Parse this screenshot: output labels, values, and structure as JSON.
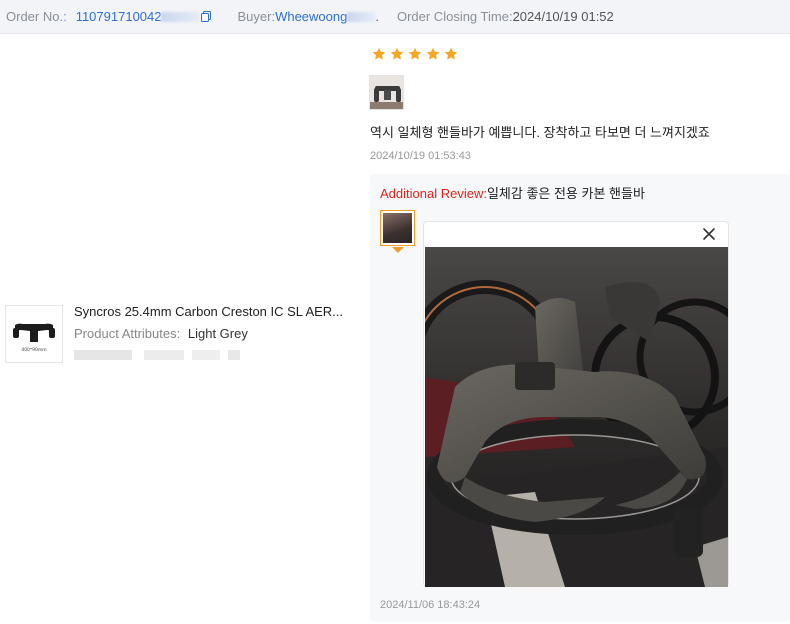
{
  "header": {
    "order_label": "Order No.:",
    "order_value": "110791710042",
    "buyer_label": "Buyer:",
    "buyer_value": "Wheewoong",
    "buyer_suffix": ".",
    "closing_label": "Order Closing Time:",
    "closing_value": "2024/10/19 01:52"
  },
  "product": {
    "title": "Syncros 25.4mm Carbon Creston IC SL AER...",
    "attr_label": "Product Attributes",
    "attr_sep": ":",
    "attr_value": "Light Grey",
    "thumb_caption": "400*90mm"
  },
  "review": {
    "rating": 5,
    "text": "역시 일체형 핸들바가 예쁩니다. 장착하고 타보면 더 느껴지겠죠",
    "time": "2024/10/19 01:53:43"
  },
  "additional": {
    "label": "Additional Review:",
    "text": "일체감 좋은 전용 카본 핸들바",
    "time": "2024/11/06 18:43:24"
  },
  "colors": {
    "star": "#f5a623",
    "link": "#2f6fd6",
    "additional_label": "#e0241b",
    "thumb_border": "#f09b2a"
  },
  "icons": [
    "copy-icon",
    "star-icon",
    "close-icon"
  ]
}
